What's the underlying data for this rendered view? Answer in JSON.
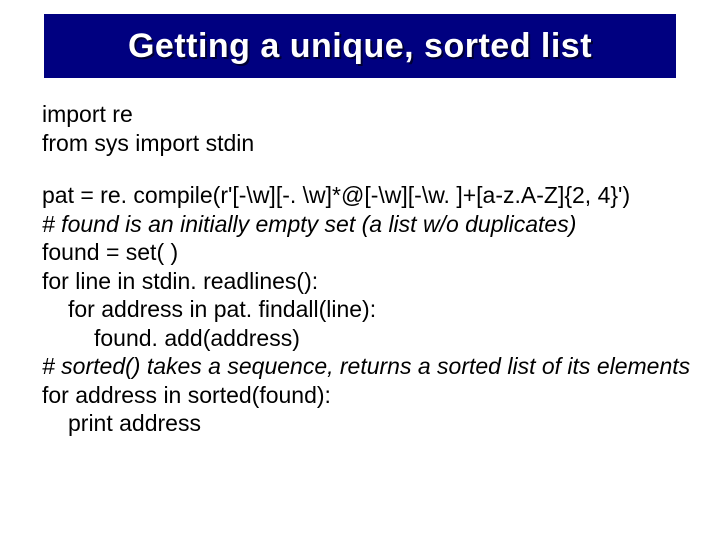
{
  "title": "Getting a unique, sorted list",
  "code": {
    "l1": "import re",
    "l2": "from sys import stdin",
    "l3": "pat = re. compile(r'[-\\w][-. \\w]*@[-\\w][-\\w. ]+[a-z.A-Z]{2, 4}')",
    "c1": "# found is an initially empty set (a list w/o duplicates)",
    "l4": "found = set( )",
    "l5": "for line in stdin. readlines():",
    "l6": "for address in pat. findall(line):",
    "l7": "found. add(address)",
    "c2": "# sorted() takes a sequence, returns a sorted list of its elements",
    "l8": "for address in sorted(found):",
    "l9": "print address"
  }
}
